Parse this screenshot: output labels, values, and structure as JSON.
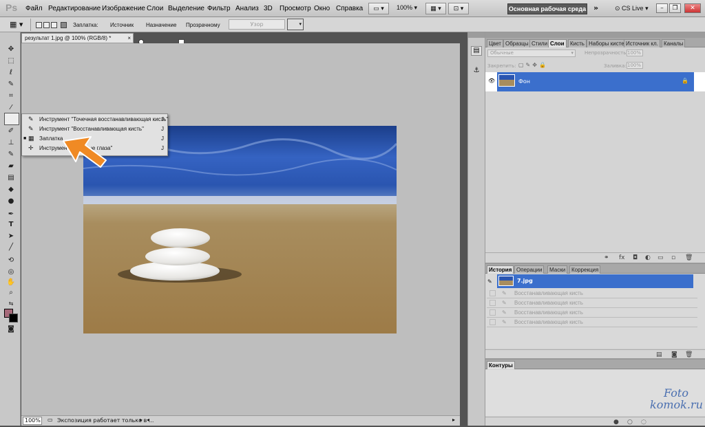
{
  "app": {
    "logo": "Ps"
  },
  "menu": [
    "Файл",
    "Редактирование",
    "Изображение",
    "Слои",
    "Выделение",
    "Фильтр",
    "Анализ",
    "3D",
    "Просмотр",
    "Окно",
    "Справка"
  ],
  "zoom_menu": "100%",
  "workspace": "Основная рабочая среда",
  "cs_live": "CS Live",
  "options": {
    "patch_label": "Заплатка:",
    "source": "Источник",
    "destination": "Назначение",
    "transparent": "Прозрачному",
    "pattern_btn": "Узор"
  },
  "document": {
    "tab": "результат 1.jpg @ 100% (RGB/8) *",
    "zoom": "100%",
    "status": "Экспозиция работает только в ..."
  },
  "flyout": [
    {
      "label": "Инструмент \"Точечная восстанавливающая кисть\"",
      "key": "J",
      "icon": "spot-healing-brush-icon",
      "glyph": "✎"
    },
    {
      "label": "Инструмент \"Восстанавливающая кисть\"",
      "key": "J",
      "icon": "healing-brush-icon",
      "glyph": "✎"
    },
    {
      "label": "Заплатка",
      "key": "J",
      "icon": "patch-icon",
      "glyph": "▦"
    },
    {
      "label": "Инструмент \"Красные глаза\"",
      "key": "J",
      "icon": "red-eye-icon",
      "glyph": "✛"
    }
  ],
  "panel_top": {
    "tabs": [
      "Цвет",
      "Образцы",
      "Стили",
      "Слои",
      "Кисть",
      "Наборы кистей",
      "Источник кл.",
      "Каналы"
    ],
    "active_tab": "Слои",
    "blend_mode": "Обычные",
    "opacity_label": "Непрозрачность:",
    "opacity_value": "100%",
    "lock_label": "Закрепить:",
    "fill_label": "Заливка:",
    "fill_value": "100%",
    "layer_name": "Фон"
  },
  "panel_history": {
    "tabs": [
      "История",
      "Операции",
      "Маски",
      "Коррекция"
    ],
    "active_tab": "История",
    "snapshot": "7.jpg",
    "items": [
      "Восстанавливающая кисть",
      "Восстанавливающая кисть",
      "Восстанавливающая кисть",
      "Восстанавливающая кисть"
    ]
  },
  "panel_paths": {
    "tabs": [
      "Контуры"
    ]
  },
  "watermark": {
    "line1": "Foto",
    "line2": "komok.ru"
  },
  "colors": {
    "selection": "#3b6fcc",
    "arrow": "#f08a24",
    "foreground": "#a66a7a",
    "background": "#000000"
  }
}
